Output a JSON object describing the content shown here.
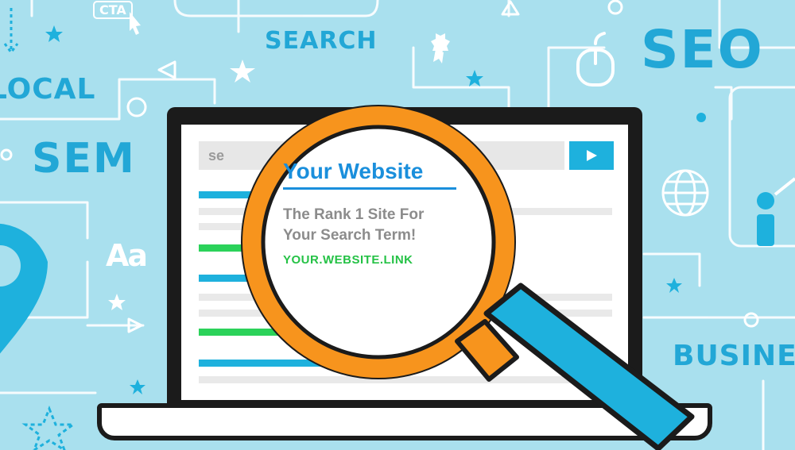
{
  "background_words": {
    "search": "SEARCH",
    "seo": "SEO",
    "local": "LOCAL",
    "sem": "SEM",
    "business": "BUSINE",
    "cta": "CTA",
    "aa": "Aa"
  },
  "browser": {
    "search_label": "se"
  },
  "result": {
    "title": "Your Website",
    "subtitle_line1": "The Rank 1 Site For",
    "subtitle_line2": "Your Search Term!",
    "link": "YOUR.WEBSITE.LINK"
  },
  "icons": [
    "magnifying-glass-icon",
    "mouse-icon",
    "globe-icon",
    "location-pin-icon",
    "cursor-icon",
    "star-icon",
    "award-badge-icon",
    "play-icon",
    "arrow-icon",
    "person-icon"
  ],
  "colors": {
    "background": "#a9e0ee",
    "accent_blue": "#1eb1dd",
    "magnifier_orange": "#f7941d",
    "handle_blue": "#1eb1dd",
    "link_green": "#25c246",
    "title_blue": "#1a8fdc"
  }
}
